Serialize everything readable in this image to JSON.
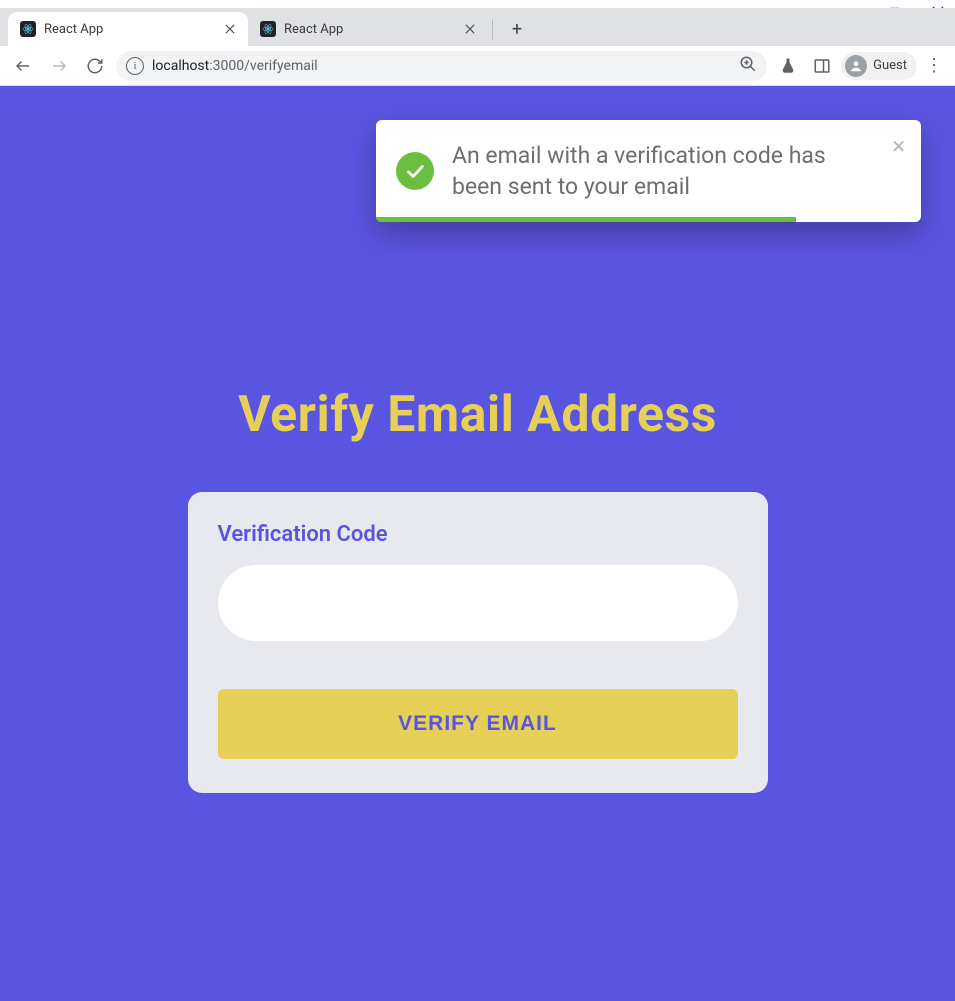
{
  "browser": {
    "tabs": [
      {
        "title": "React App",
        "active": true
      },
      {
        "title": "React App",
        "active": false
      }
    ],
    "url_host": "localhost",
    "url_port_path": ":3000/verifyemail",
    "guest_label": "Guest"
  },
  "toast": {
    "message": "An email with a verification code has been sent to your email"
  },
  "page": {
    "heading": "Verify Email Address",
    "field_label": "Verification Code",
    "input_value": "",
    "button_label": "VERIFY EMAIL"
  }
}
